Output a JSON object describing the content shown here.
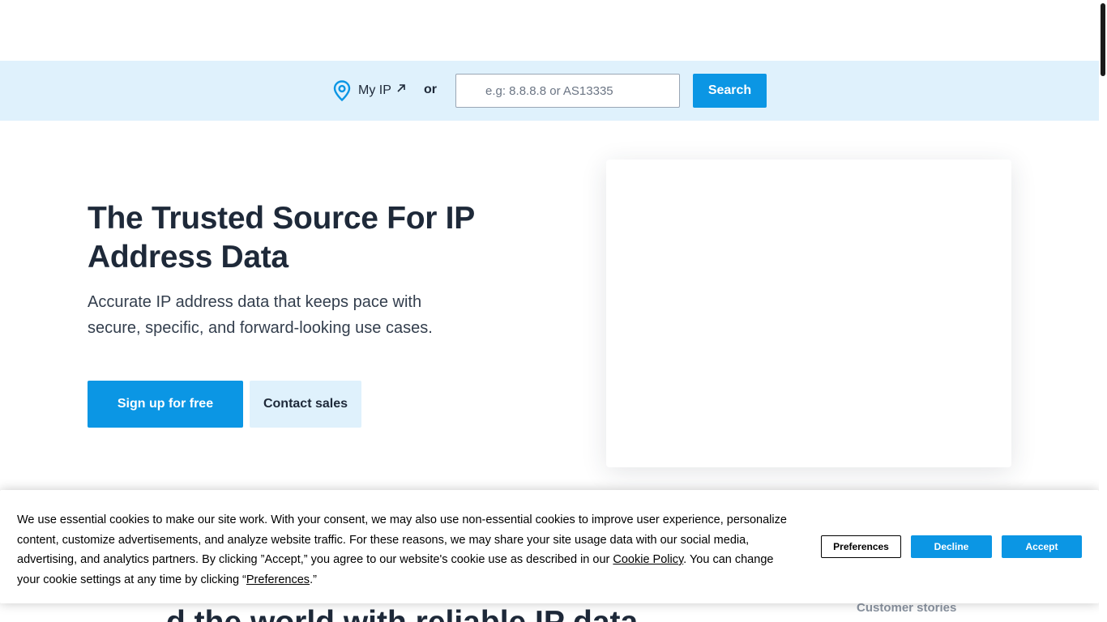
{
  "search_bar": {
    "my_ip_label": "My IP",
    "or_label": "or",
    "input_placeholder": "e.g: 8.8.8.8 or AS13335",
    "input_value": "",
    "search_button_label": "Search"
  },
  "hero": {
    "title": "The Trusted Source For IP Address Data",
    "subtitle": "Accurate IP address data that keeps pace with secure, specific, and forward-looking use cases.",
    "signup_label": "Sign up for free",
    "contact_label": "Contact sales"
  },
  "below_fold": {
    "partial_heading": "d the world with reliable IP data",
    "customer_stories": "Customer stories"
  },
  "cookie_banner": {
    "text_part1": "We use essential cookies to make our site work. With your consent, we may also use non-essential cookies to improve user experience, personalize content, customize advertisements, and analyze website traffic. For these reasons, we may share your site usage data with our social media, advertising, and analytics partners. By clicking ”Accept,” you agree to our website's cookie use as described in our ",
    "cookie_policy_link": "Cookie Policy",
    "text_part2": ". You can change your cookie settings at any time by clicking “",
    "preferences_link": "Preferences",
    "text_part3": ".”",
    "preferences_button": "Preferences",
    "decline_button": "Decline",
    "accept_button": "Accept"
  },
  "colors": {
    "accent": "#0b96e4",
    "search_bar_bg": "#dff1fc",
    "heading": "#1e2939"
  },
  "icons": {
    "location": "location-pin-icon",
    "external": "external-arrow-icon"
  }
}
